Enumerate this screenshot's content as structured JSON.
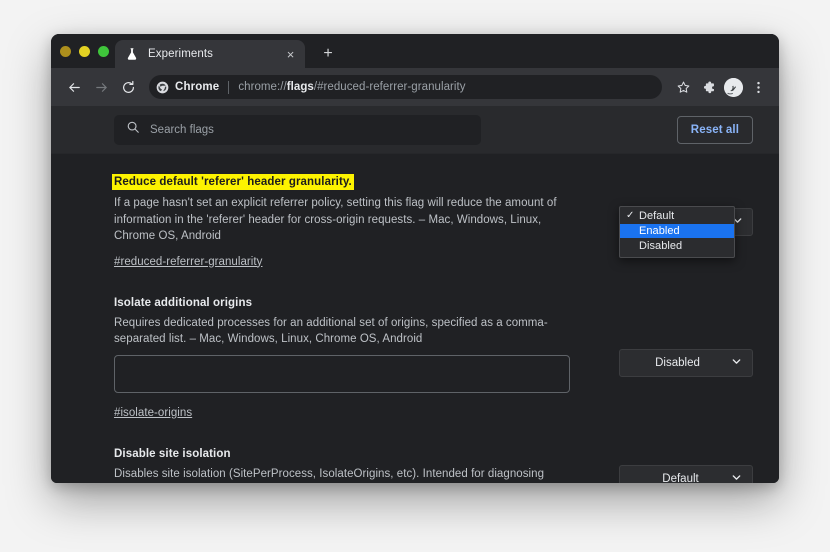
{
  "window": {
    "traffic_lights": [
      "close",
      "minimize",
      "maximize"
    ]
  },
  "tabstrip": {
    "tab": {
      "title": "Experiments",
      "favicon": "flask-icon",
      "close": "×"
    },
    "new_tab": "+"
  },
  "toolbar": {
    "back": "back-arrow-icon",
    "forward": "forward-arrow-icon",
    "reload": "reload-icon",
    "omnibox": {
      "chip_icon": "chrome-logo-icon",
      "chip_label": "Chrome",
      "url_prefix": "chrome://",
      "url_bold": "flags",
      "url_suffix": "/#reduced-referrer-granularity",
      "url_full": "chrome://flags/#reduced-referrer-granularity"
    },
    "bookmark": "star-icon",
    "extensions": "puzzle-icon",
    "profile": "avatar-icon",
    "menu": "three-dot-menu-icon"
  },
  "flags_toolbar": {
    "search": {
      "icon": "search-icon",
      "placeholder": "Search flags",
      "value": ""
    },
    "reset_all_label": "Reset all"
  },
  "flags": [
    {
      "title": "Reduce default 'referer' header granularity.",
      "highlighted": true,
      "description": "If a page hasn't set an explicit referrer policy, setting this flag will reduce the amount of information in the 'referer' header for cross-origin requests. – Mac, Windows, Linux, Chrome OS, Android",
      "anchor": "#reduced-referrer-granularity",
      "select": {
        "value": "Default",
        "open": true,
        "options": [
          {
            "label": "Default",
            "checked": true,
            "highlighted": false
          },
          {
            "label": "Enabled",
            "checked": false,
            "highlighted": true
          },
          {
            "label": "Disabled",
            "checked": false,
            "highlighted": false
          }
        ]
      }
    },
    {
      "title": "Isolate additional origins",
      "highlighted": false,
      "description": "Requires dedicated processes for an additional set of origins, specified as a comma-separated list. – Mac, Windows, Linux, Chrome OS, Android",
      "anchor": "#isolate-origins",
      "textfield": {
        "value": "",
        "placeholder": ""
      },
      "select": {
        "value": "Disabled",
        "open": false
      }
    },
    {
      "title": "Disable site isolation",
      "highlighted": false,
      "description": "Disables site isolation (SitePerProcess, IsolateOrigins, etc). Intended for diagnosing bugs that may be due to out-of-process iframes. Opt-out has no effect if site isolation is force-enabled using a command line switch or using an enterprise policy. Caution: this disables",
      "select": {
        "value": "Default",
        "open": false
      }
    }
  ],
  "colors": {
    "page_bg": "#202124",
    "toolbar_bg": "#35363a",
    "flags_toolbar_bg": "#292a2d",
    "accent_blue": "#8ab4f8",
    "highlight_yellow": "#fdf300",
    "selection_blue": "#1a73f0",
    "text_primary": "#e8eaed",
    "text_secondary": "#bdc1c6"
  }
}
